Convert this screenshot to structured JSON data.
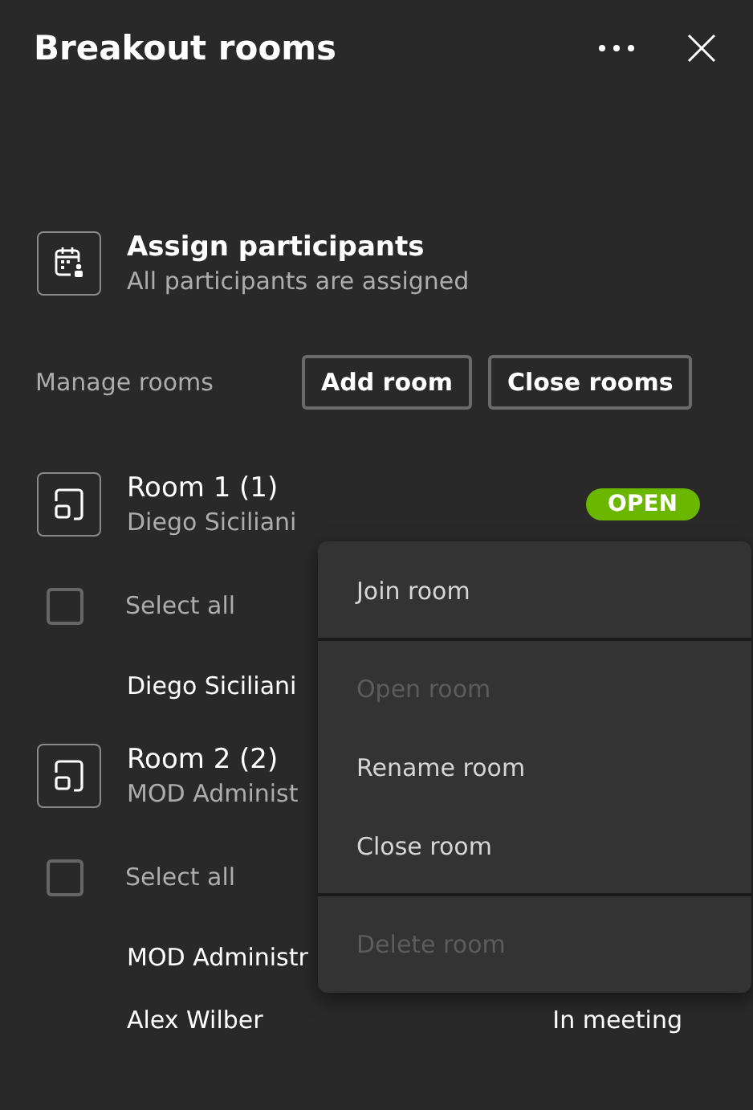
{
  "panel": {
    "title": "Breakout rooms"
  },
  "assign": {
    "title": "Assign participants",
    "subtitle": "All participants are assigned"
  },
  "manage": {
    "label": "Manage rooms",
    "buttons": [
      "Add room",
      "Close rooms"
    ]
  },
  "rooms": [
    {
      "name": "Room 1 (1)",
      "subtitle": "Diego Siciliani",
      "status": "OPEN",
      "select_all": {
        "label": "Select all",
        "checked": false
      },
      "members": [
        {
          "name": "Diego Siciliani"
        }
      ]
    },
    {
      "name": "Room 2 (2)",
      "subtitle": "MOD Administ",
      "select_all": {
        "label": "Select all",
        "checked": false
      },
      "members": [
        {
          "name": "MOD Administr"
        },
        {
          "name": "Alex Wilber",
          "status": "In meeting"
        }
      ]
    }
  ],
  "context_menu": [
    {
      "kind": "item",
      "label": "Join room",
      "disabled": false
    },
    {
      "kind": "divider"
    },
    {
      "kind": "item",
      "label": "Open room",
      "disabled": true
    },
    {
      "kind": "item",
      "label": "Rename room",
      "disabled": false
    },
    {
      "kind": "item",
      "label": "Close room",
      "disabled": false
    },
    {
      "kind": "divider"
    },
    {
      "kind": "item",
      "label": "Delete room",
      "disabled": true
    }
  ]
}
